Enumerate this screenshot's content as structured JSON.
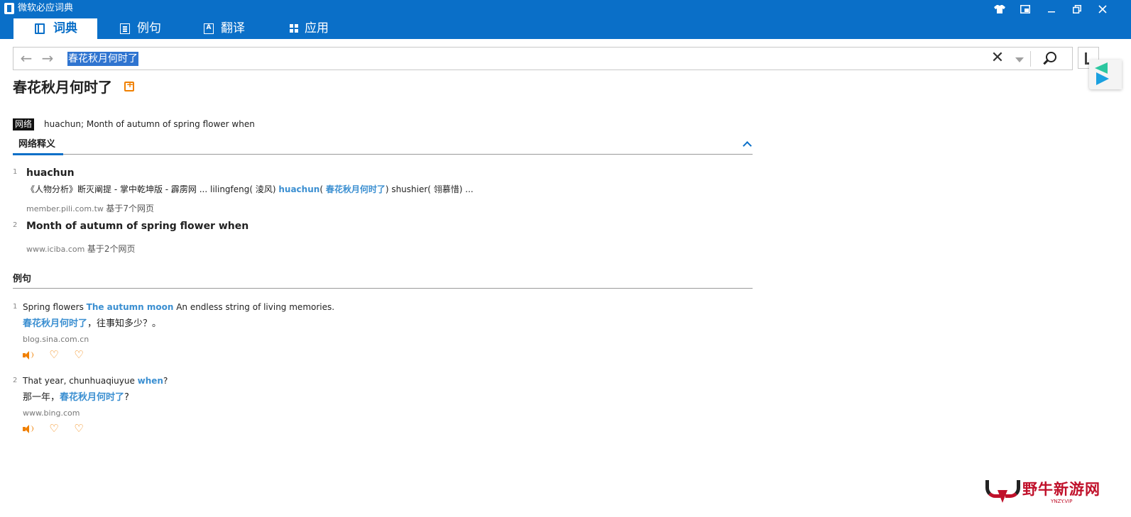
{
  "app": {
    "title": "微软必应词典"
  },
  "window_controls": [
    "skin-icon",
    "mini-mode-icon",
    "minimize-icon",
    "restore-icon",
    "close-icon"
  ],
  "tabs": [
    {
      "label": "词典",
      "icon": "book-icon",
      "active": true
    },
    {
      "label": "例句",
      "icon": "pages-icon",
      "active": false
    },
    {
      "label": "翻译",
      "icon": "translate-icon",
      "active": false
    },
    {
      "label": "应用",
      "icon": "apps-grid-icon",
      "active": false
    }
  ],
  "search": {
    "value": "春花秋月何时了",
    "selected_text": "春花秋月何时了"
  },
  "entry": {
    "word": "春花秋月何时了",
    "net_tag": "网络",
    "net_definition": "huachun; Month of autumn of spring flower when"
  },
  "net_section": {
    "title": "网络释义",
    "items": [
      {
        "num": "1",
        "title": "huachun",
        "context_pre": "《人物分析》断灭阐提 - 掌中乾坤版 - 霹雳网 ... lilingfeng( 淩风) ",
        "context_hl1": "huachun",
        "context_mid1": "( ",
        "context_hl2": "春花秋月何时了",
        "context_post": ") shushier( 翎慕惜) ...",
        "source": "member.pili.com.tw",
        "source_note": "基于7个网页"
      },
      {
        "num": "2",
        "title": "Month of autumn of spring flower when",
        "source": "www.iciba.com",
        "source_note": "基于2个网页"
      }
    ]
  },
  "examples_section": {
    "title": "例句",
    "items": [
      {
        "num": "1",
        "en_pre": "Spring flowers ",
        "en_hl": "The autumn moon",
        "en_post": " An endless string of living memories.",
        "cn_pre": "",
        "cn_hl": "春花秋月何时了",
        "cn_post": "，往事知多少？。",
        "source": "blog.sina.com.cn"
      },
      {
        "num": "2",
        "en_pre": "That year, chunhuaqiuyue ",
        "en_hl": "when",
        "en_post": "?",
        "cn_pre": "那一年，",
        "cn_hl": "春花秋月何时了",
        "cn_post": "?",
        "source": "www.bing.com"
      }
    ]
  },
  "watermark": {
    "text": "野牛新游网",
    "sub": "YNZY.VIP"
  },
  "colors": {
    "titlebar": "#0a6fc8",
    "highlight": "#3b8fd1",
    "accent": "#f08000"
  }
}
